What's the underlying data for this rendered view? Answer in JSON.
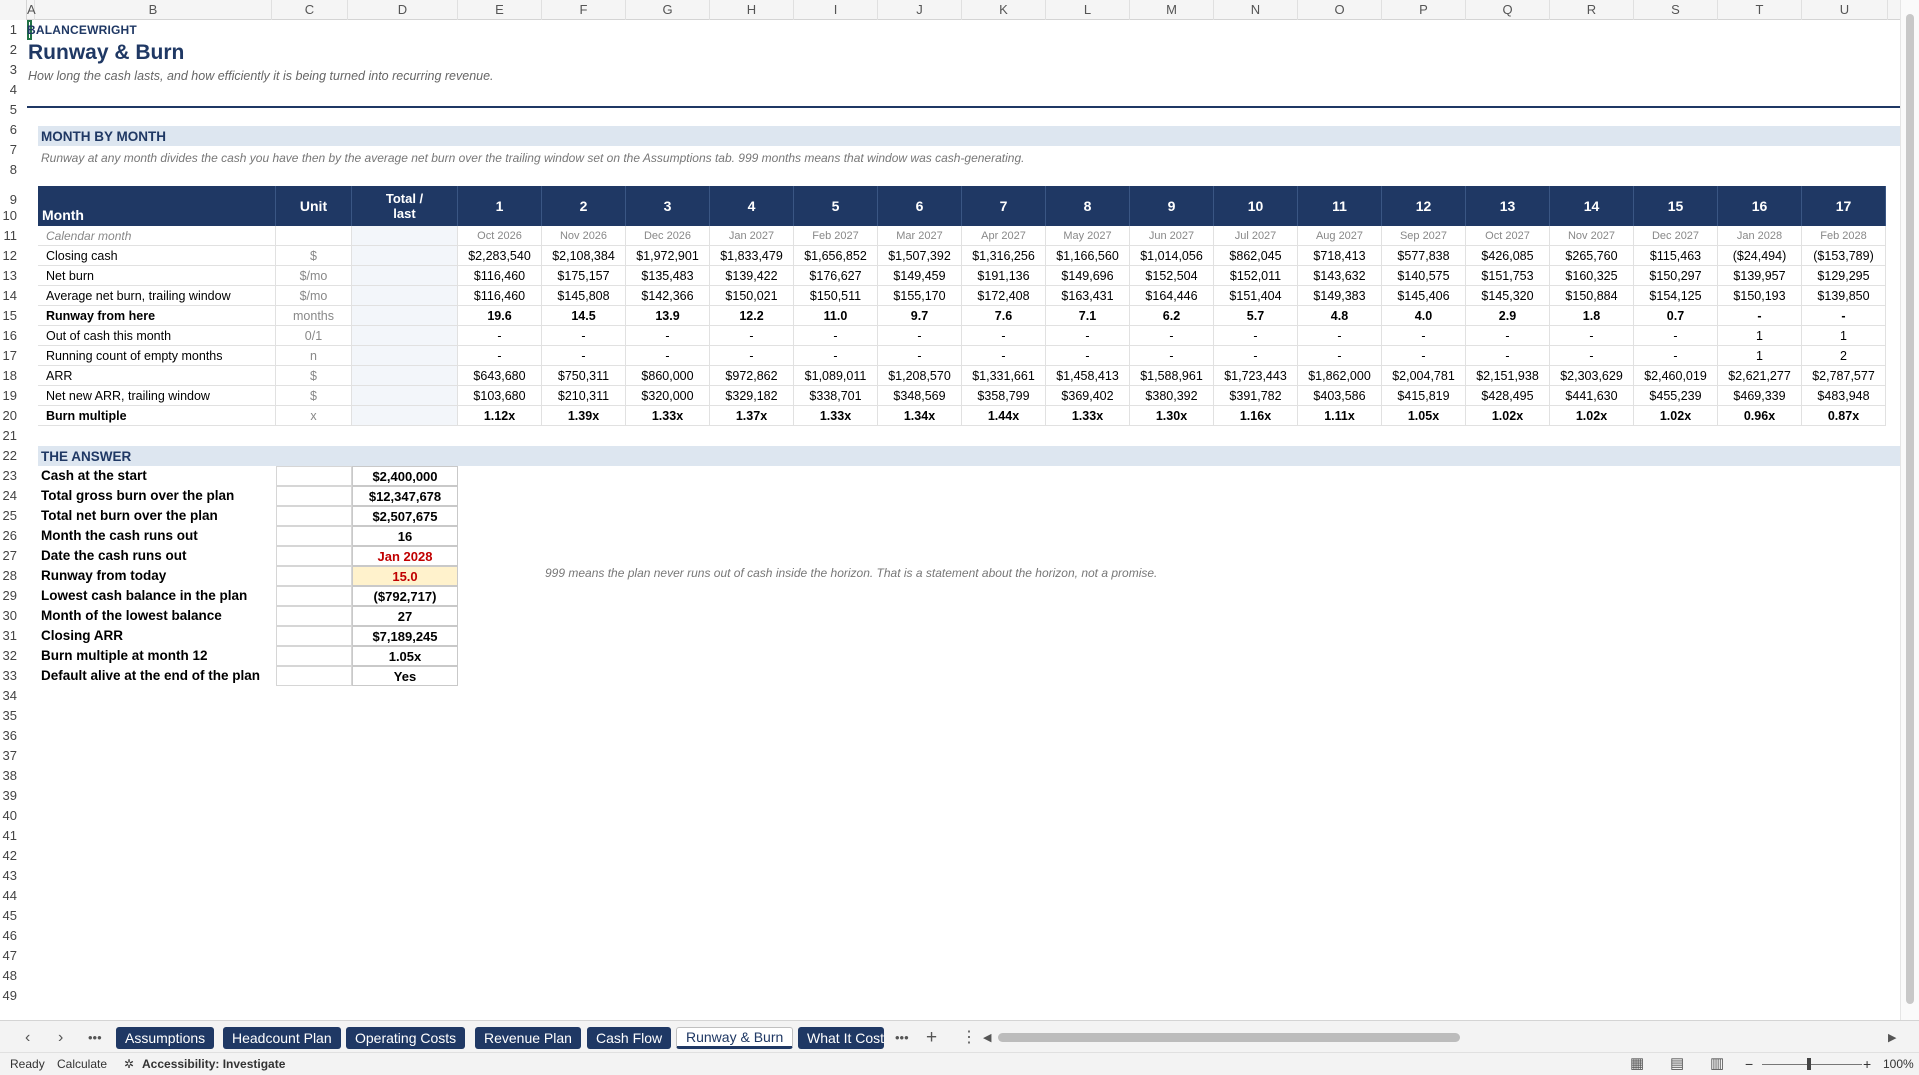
{
  "columns": [
    "A",
    "B",
    "C",
    "D",
    "E",
    "F",
    "G",
    "H",
    "I",
    "J",
    "K",
    "L",
    "M",
    "N",
    "O",
    "P",
    "Q",
    "R",
    "S",
    "T",
    "U"
  ],
  "rows": [
    "1",
    "2",
    "3",
    "4",
    "5",
    "6",
    "7",
    "8",
    "9",
    "10",
    "11",
    "12",
    "13",
    "14",
    "15",
    "16",
    "17",
    "18",
    "19",
    "20",
    "21",
    "22",
    "23",
    "24",
    "25",
    "26",
    "27",
    "28",
    "29",
    "30",
    "31",
    "32",
    "33",
    "34",
    "35",
    "36",
    "37",
    "38",
    "39",
    "40",
    "41",
    "42",
    "43",
    "44",
    "45",
    "46",
    "47",
    "48",
    "49"
  ],
  "brand": "BALANCEWRIGHT",
  "title": "Runway & Burn",
  "subtitle": "How long the cash lasts, and how efficiently it is being turned into recurring revenue.",
  "section1": "MONTH BY MONTH",
  "section1_note": "Runway at any month divides the cash you have then by the average net burn over the trailing window set on the Assumptions tab. 999 months means that window was cash-generating.",
  "header": {
    "month": "Month",
    "unit": "Unit",
    "total": "Total /\nlast"
  },
  "months": [
    "1",
    "2",
    "3",
    "4",
    "5",
    "6",
    "7",
    "8",
    "9",
    "10",
    "11",
    "12",
    "13",
    "14",
    "15",
    "16",
    "17"
  ],
  "calendar": [
    "Oct 2026",
    "Nov 2026",
    "Dec 2026",
    "Jan 2027",
    "Feb 2027",
    "Mar 2027",
    "Apr 2027",
    "May 2027",
    "Jun 2027",
    "Jul 2027",
    "Aug 2027",
    "Sep 2027",
    "Oct 2027",
    "Nov 2027",
    "Dec 2027",
    "Jan 2028",
    "Feb 2028"
  ],
  "table": [
    {
      "label": "Calendar month",
      "unit": "",
      "bold": false,
      "italic": true,
      "values": []
    },
    {
      "label": "Closing cash",
      "unit": "$",
      "bold": false,
      "values": [
        "$2,283,540",
        "$2,108,384",
        "$1,972,901",
        "$1,833,479",
        "$1,656,852",
        "$1,507,392",
        "$1,316,256",
        "$1,166,560",
        "$1,014,056",
        "$862,045",
        "$718,413",
        "$577,838",
        "$426,085",
        "$265,760",
        "$115,463",
        "($24,494)",
        "($153,789)"
      ]
    },
    {
      "label": "Net burn",
      "unit": "$/mo",
      "bold": false,
      "values": [
        "$116,460",
        "$175,157",
        "$135,483",
        "$139,422",
        "$176,627",
        "$149,459",
        "$191,136",
        "$149,696",
        "$152,504",
        "$152,011",
        "$143,632",
        "$140,575",
        "$151,753",
        "$160,325",
        "$150,297",
        "$139,957",
        "$129,295"
      ]
    },
    {
      "label": "Average net burn, trailing window",
      "unit": "$/mo",
      "bold": false,
      "values": [
        "$116,460",
        "$145,808",
        "$142,366",
        "$150,021",
        "$150,511",
        "$155,170",
        "$172,408",
        "$163,431",
        "$164,446",
        "$151,404",
        "$149,383",
        "$145,406",
        "$145,320",
        "$150,884",
        "$154,125",
        "$150,193",
        "$139,850"
      ]
    },
    {
      "label": "Runway from here",
      "unit": "months",
      "bold": true,
      "values": [
        "19.6",
        "14.5",
        "13.9",
        "12.2",
        "11.0",
        "9.7",
        "7.6",
        "7.1",
        "6.2",
        "5.7",
        "4.8",
        "4.0",
        "2.9",
        "1.8",
        "0.7",
        "-",
        "-"
      ]
    },
    {
      "label": "Out of cash this month",
      "unit": "0/1",
      "bold": false,
      "values": [
        "-",
        "-",
        "-",
        "-",
        "-",
        "-",
        "-",
        "-",
        "-",
        "-",
        "-",
        "-",
        "-",
        "-",
        "-",
        "1",
        "1"
      ]
    },
    {
      "label": "Running count of empty months",
      "unit": "n",
      "bold": false,
      "values": [
        "-",
        "-",
        "-",
        "-",
        "-",
        "-",
        "-",
        "-",
        "-",
        "-",
        "-",
        "-",
        "-",
        "-",
        "-",
        "1",
        "2"
      ]
    },
    {
      "label": "ARR",
      "unit": "$",
      "bold": false,
      "values": [
        "$643,680",
        "$750,311",
        "$860,000",
        "$972,862",
        "$1,089,011",
        "$1,208,570",
        "$1,331,661",
        "$1,458,413",
        "$1,588,961",
        "$1,723,443",
        "$1,862,000",
        "$2,004,781",
        "$2,151,938",
        "$2,303,629",
        "$2,460,019",
        "$2,621,277",
        "$2,787,577"
      ]
    },
    {
      "label": "Net new ARR, trailing window",
      "unit": "$",
      "bold": false,
      "values": [
        "$103,680",
        "$210,311",
        "$320,000",
        "$329,182",
        "$338,701",
        "$348,569",
        "$358,799",
        "$369,402",
        "$380,392",
        "$391,782",
        "$403,586",
        "$415,819",
        "$428,495",
        "$441,630",
        "$455,239",
        "$469,339",
        "$483,948"
      ]
    },
    {
      "label": "Burn multiple",
      "unit": "x",
      "bold": true,
      "values": [
        "1.12x",
        "1.39x",
        "1.33x",
        "1.37x",
        "1.33x",
        "1.34x",
        "1.44x",
        "1.33x",
        "1.30x",
        "1.16x",
        "1.11x",
        "1.05x",
        "1.02x",
        "1.02x",
        "1.02x",
        "0.96x",
        "0.87x"
      ]
    }
  ],
  "section2": "THE ANSWER",
  "answers": [
    {
      "label": "Cash at the start",
      "value": "$2,400,000",
      "style": ""
    },
    {
      "label": "Total gross burn over the plan",
      "value": "$12,347,678",
      "style": ""
    },
    {
      "label": "Total net burn over the plan",
      "value": "$2,507,675",
      "style": ""
    },
    {
      "label": "Month the cash runs out",
      "value": "16",
      "style": ""
    },
    {
      "label": "Date the cash runs out",
      "value": "Jan 2028",
      "style": "red"
    },
    {
      "label": "Runway from today",
      "value": "15.0",
      "style": "yel"
    },
    {
      "label": "Lowest cash balance in the plan",
      "value": "($792,717)",
      "style": ""
    },
    {
      "label": "Month of the lowest balance",
      "value": "27",
      "style": ""
    },
    {
      "label": "Closing ARR",
      "value": "$7,189,245",
      "style": ""
    },
    {
      "label": "Burn multiple at month 12",
      "value": "1.05x",
      "style": ""
    },
    {
      "label": "Default alive at the end of the plan",
      "value": "Yes",
      "style": ""
    }
  ],
  "runway_note": "999 means the plan never runs out of cash inside the horizon. That is a statement about the horizon, not a promise.",
  "tabs": [
    "Assumptions",
    "Headcount Plan",
    "Operating Costs",
    "Revenue Plan",
    "Cash Flow",
    "Runway & Burn",
    "What It Cost"
  ],
  "active_tab": "Runway & Burn",
  "status": {
    "ready": "Ready",
    "calculate": "Calculate",
    "accessibility": "Accessibility: Investigate",
    "zoom": "100%"
  },
  "colors": {
    "navy": "#1f3864",
    "band": "#dde6f0",
    "red": "#c00000",
    "yellow": "#fff2cc"
  }
}
